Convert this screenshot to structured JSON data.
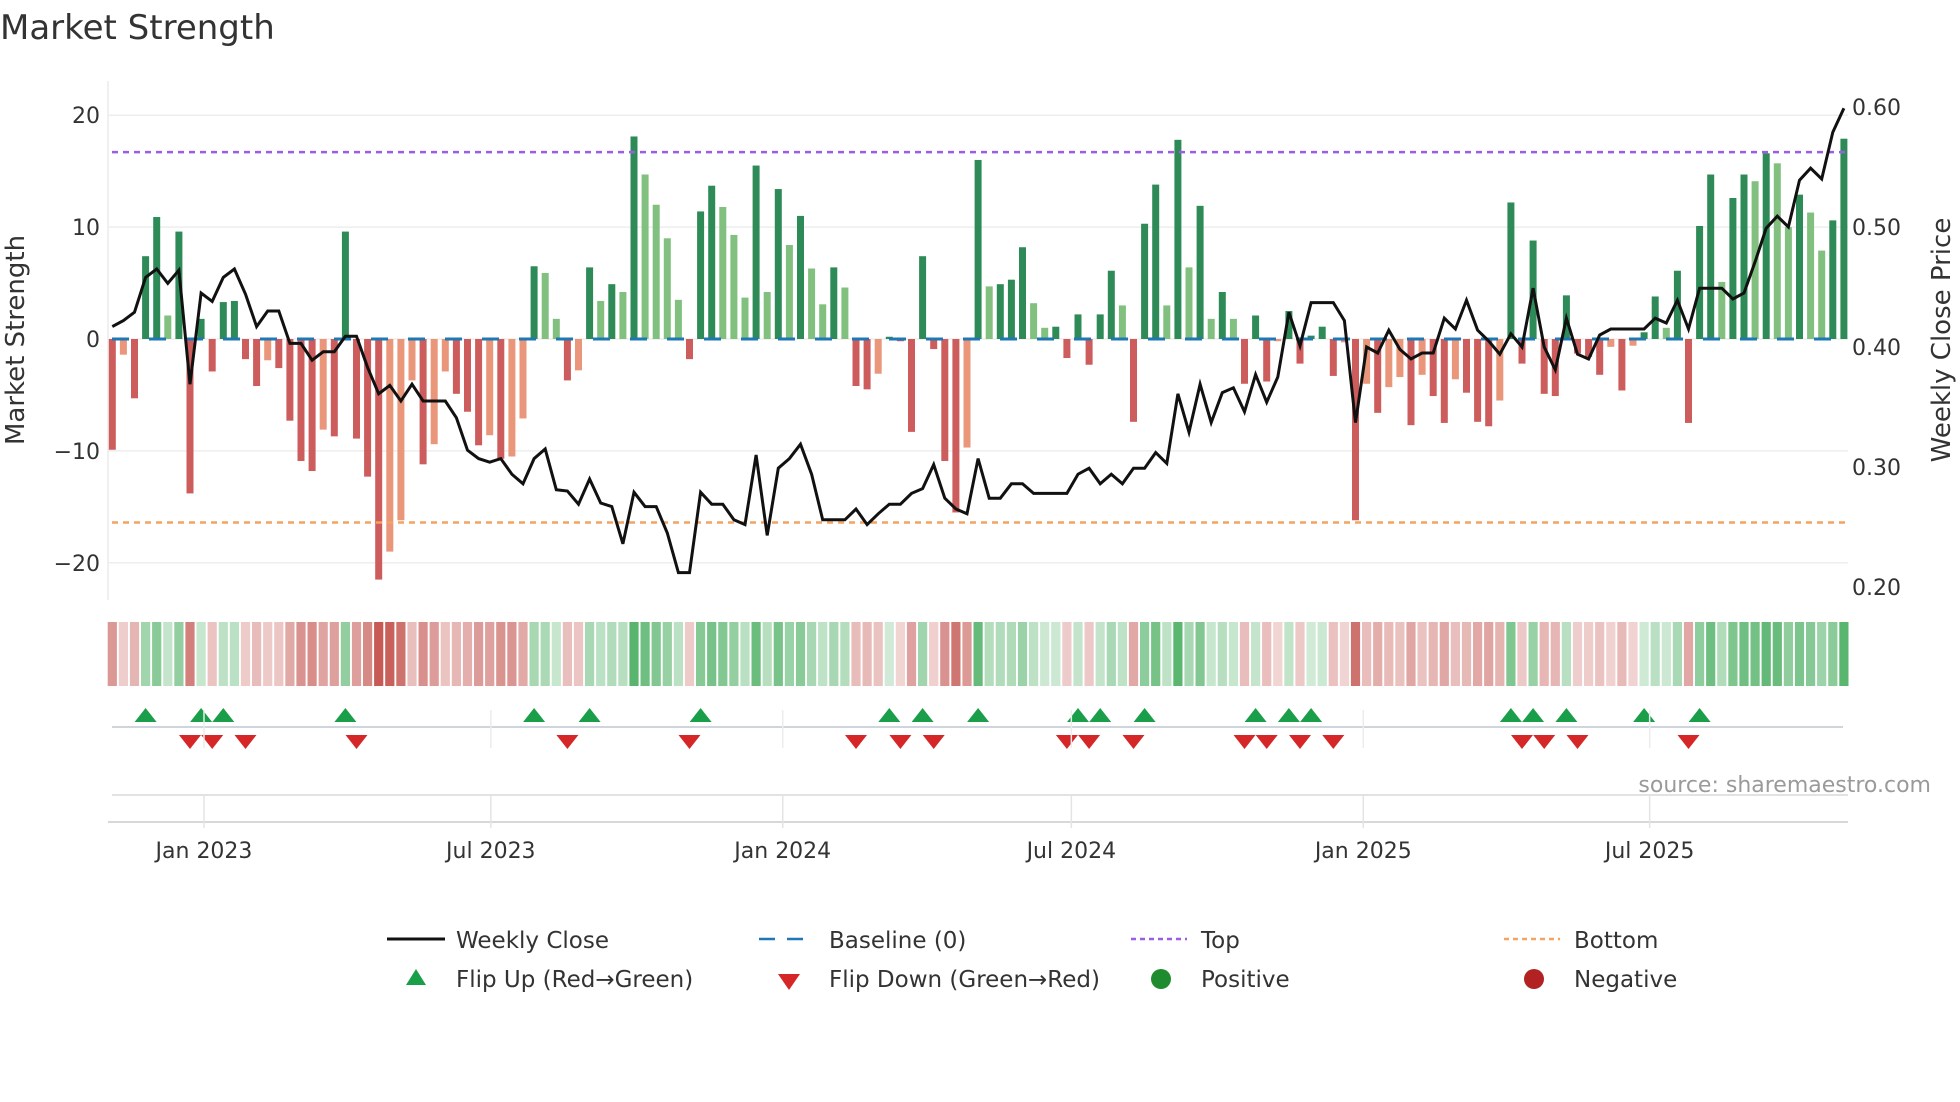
{
  "chart_data": {
    "type": "bar",
    "title": "Market Strength",
    "ylabel": "Market Strength",
    "y2label": "Weekly Close Price",
    "ylim": [
      -23.3,
      23
    ],
    "y2lim": [
      0.18,
      0.62
    ],
    "yticks": [
      20,
      10,
      0,
      -10,
      -20
    ],
    "yticklabels": [
      "20",
      "10",
      "0",
      "−10",
      "−20"
    ],
    "y2ticks": [
      0.6,
      0.5,
      0.4,
      0.3,
      0.2
    ],
    "y2ticklabels": [
      "0.60",
      "0.50",
      "0.40",
      "0.30",
      "0.20"
    ],
    "xunit": "week index",
    "xticks": [
      {
        "label": "Jan 2023",
        "week": 9.26
      },
      {
        "label": "Jul 2023",
        "week": 35.1
      },
      {
        "label": "Jan 2024",
        "week": 61.4
      },
      {
        "label": "Jul 2024",
        "week": 87.4
      },
      {
        "label": "Jan 2025",
        "week": 113.7
      },
      {
        "label": "Jul 2025",
        "week": 139.5
      }
    ],
    "grid": true,
    "top_level": 16.7,
    "bottom_level": -16.4,
    "baseline": 0,
    "strength": [
      -9.9,
      -1.4,
      -5.3,
      7.4,
      10.9,
      2.1,
      9.6,
      -13.8,
      1.8,
      -2.9,
      3.3,
      3.4,
      -1.8,
      -4.2,
      -1.9,
      -2.6,
      -7.3,
      -10.9,
      -11.8,
      -8.1,
      -8.7,
      9.6,
      -8.9,
      -12.3,
      -21.5,
      -19.0,
      -16.2,
      -3.7,
      -11.2,
      -9.4,
      -2.9,
      -4.9,
      -6.5,
      -9.5,
      -8.6,
      -10.7,
      -10.5,
      -7.1,
      6.5,
      5.9,
      1.8,
      -3.7,
      -2.8,
      6.4,
      3.4,
      4.9,
      4.2,
      18.1,
      14.7,
      12.0,
      9.0,
      3.5,
      -1.8,
      11.4,
      13.7,
      11.8,
      9.3,
      3.7,
      15.5,
      4.2,
      13.4,
      8.4,
      11.0,
      6.3,
      3.1,
      6.4,
      4.6,
      -4.2,
      -4.5,
      -3.1,
      0.2,
      -0.2,
      -8.3,
      7.4,
      -0.9,
      -10.9,
      -15.5,
      -9.7,
      16.0,
      4.7,
      4.9,
      5.3,
      8.2,
      3.2,
      1.0,
      1.1,
      -1.7,
      2.2,
      -2.3,
      2.2,
      6.1,
      3.0,
      -7.4,
      10.3,
      13.8,
      3.0,
      17.8,
      6.4,
      11.9,
      1.8,
      4.2,
      1.8,
      -4.0,
      2.1,
      -3.8,
      -0.2,
      2.5,
      -2.2,
      0.3,
      1.1,
      -3.3,
      -0.3,
      -16.2,
      -4.0,
      -6.6,
      -4.3,
      -3.4,
      -7.7,
      -3.2,
      -5.1,
      -7.5,
      -3.6,
      -4.8,
      -7.4,
      -7.8,
      -5.5,
      12.2,
      -2.2,
      8.8,
      -4.9,
      -5.1,
      3.9,
      -1.3,
      -1.6,
      -3.2,
      -0.7,
      -4.6,
      -0.6,
      0.6,
      3.8,
      1.0,
      6.1,
      -7.5,
      10.1,
      14.7,
      5.1,
      12.6,
      14.7,
      14.1,
      16.6,
      15.7,
      10.0,
      12.9,
      11.3,
      7.9,
      10.6,
      17.9
    ],
    "weekly_close": [
      0.417,
      0.422,
      0.429,
      0.458,
      0.465,
      0.453,
      0.464,
      0.369,
      0.445,
      0.438,
      0.458,
      0.465,
      0.444,
      0.417,
      0.43,
      0.43,
      0.403,
      0.403,
      0.389,
      0.396,
      0.396,
      0.409,
      0.409,
      0.383,
      0.361,
      0.368,
      0.355,
      0.369,
      0.355,
      0.355,
      0.355,
      0.341,
      0.314,
      0.307,
      0.304,
      0.307,
      0.294,
      0.286,
      0.307,
      0.315,
      0.281,
      0.28,
      0.269,
      0.29,
      0.27,
      0.267,
      0.236,
      0.279,
      0.267,
      0.267,
      0.245,
      0.212,
      0.212,
      0.279,
      0.269,
      0.269,
      0.256,
      0.252,
      0.31,
      0.243,
      0.299,
      0.307,
      0.319,
      0.294,
      0.256,
      0.256,
      0.256,
      0.265,
      0.252,
      0.261,
      0.269,
      0.269,
      0.278,
      0.282,
      0.302,
      0.274,
      0.265,
      0.261,
      0.307,
      0.274,
      0.274,
      0.286,
      0.286,
      0.278,
      0.278,
      0.278,
      0.278,
      0.294,
      0.299,
      0.286,
      0.294,
      0.286,
      0.299,
      0.299,
      0.312,
      0.303,
      0.361,
      0.329,
      0.369,
      0.337,
      0.362,
      0.366,
      0.346,
      0.377,
      0.354,
      0.375,
      0.429,
      0.401,
      0.437,
      0.437,
      0.437,
      0.422,
      0.337,
      0.4,
      0.395,
      0.414,
      0.398,
      0.39,
      0.395,
      0.395,
      0.424,
      0.415,
      0.439,
      0.414,
      0.405,
      0.394,
      0.411,
      0.4,
      0.449,
      0.4,
      0.381,
      0.424,
      0.394,
      0.39,
      0.41,
      0.415,
      0.415,
      0.415,
      0.415,
      0.424,
      0.42,
      0.439,
      0.415,
      0.449,
      0.449,
      0.449,
      0.44,
      0.445,
      0.471,
      0.499,
      0.509,
      0.5,
      0.539,
      0.549,
      0.54,
      0.579,
      0.599
    ],
    "flip_up_weeks": [
      4,
      9,
      11,
      22,
      39,
      44,
      54,
      71,
      74,
      79,
      88,
      90,
      94,
      104,
      107,
      109,
      127,
      129,
      132,
      139,
      144
    ],
    "flip_down_weeks": [
      8,
      10,
      13,
      23,
      42,
      53,
      68,
      72,
      75,
      87,
      89,
      93,
      103,
      105,
      108,
      111,
      128,
      130,
      133,
      143
    ],
    "legend": {
      "placement": "bottom",
      "items": [
        {
          "label": "Weekly Close",
          "symbol": "line"
        },
        {
          "label": "Baseline (0)",
          "symbol": "dash"
        },
        {
          "label": "Top",
          "symbol": "dot"
        },
        {
          "label": "Bottom",
          "symbol": "dot"
        },
        {
          "label": "Flip Up (Red→Green)",
          "symbol": "triangle-up"
        },
        {
          "label": "Flip Down (Green→Red)",
          "symbol": "triangle-down"
        },
        {
          "label": "Positive",
          "symbol": "circle"
        },
        {
          "label": "Negative",
          "symbol": "circle"
        }
      ]
    },
    "source": "source: sharemaestro.com"
  },
  "colors": {
    "pos_strong": "#2e8b57",
    "pos_weak": "#81c07f",
    "neg_strong": "#cd5c5c",
    "neg_weak": "#e9967a",
    "line": "#111111",
    "baseline": "#1f77b4",
    "top": "#9b5de5",
    "bottom": "#f4a460",
    "flip_up": "#1a9e4a",
    "flip_down": "#d62728",
    "positive": "#1e8c2e",
    "negative": "#b22222"
  }
}
